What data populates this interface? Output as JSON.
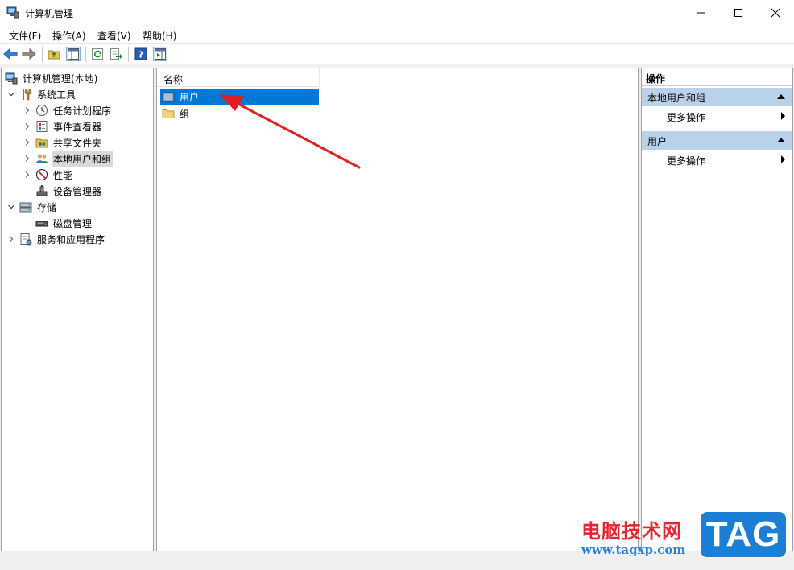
{
  "window": {
    "title": "计算机管理"
  },
  "menu": [
    "文件(F)",
    "操作(A)",
    "查看(V)",
    "帮助(H)"
  ],
  "tree": {
    "root": "计算机管理(本地)",
    "system_tools": "系统工具",
    "task_scheduler": "任务计划程序",
    "event_viewer": "事件查看器",
    "shared_folders": "共享文件夹",
    "local_users": "本地用户和组",
    "performance": "性能",
    "device_manager": "设备管理器",
    "storage": "存储",
    "disk_management": "磁盘管理",
    "services_apps": "服务和应用程序"
  },
  "list": {
    "column_name": "名称",
    "items": [
      "用户",
      "组"
    ]
  },
  "actions": {
    "title": "操作",
    "section1": "本地用户和组",
    "section1_more": "更多操作",
    "section2": "用户",
    "section2_more": "更多操作"
  },
  "watermark": {
    "cn": "电脑技术网",
    "url": "www.tagxp.com",
    "tag": "TAG"
  },
  "colors": {
    "selection": "#0078d7",
    "section_bg": "#b9d1ea",
    "annotation_arrow": "#e02020"
  }
}
